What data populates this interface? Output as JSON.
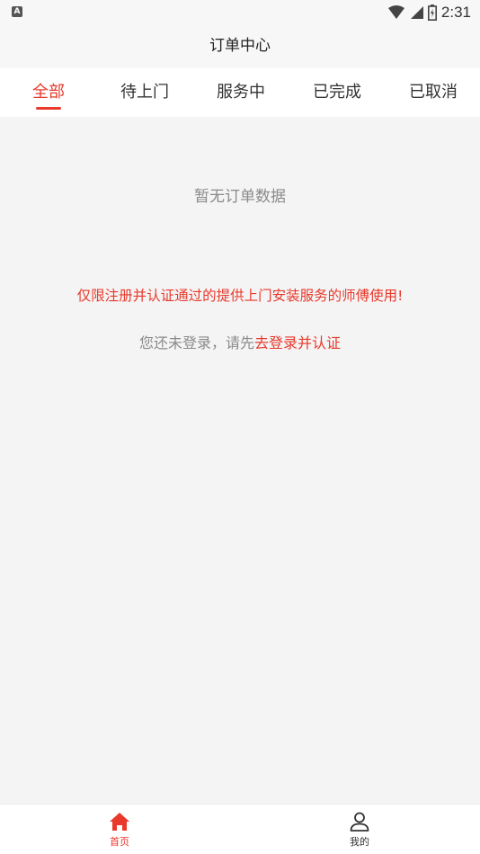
{
  "status_bar": {
    "indicator": "A",
    "time": "2:31",
    "icons": [
      "wifi-icon",
      "signal-icon",
      "battery-icon"
    ]
  },
  "header": {
    "title": "订单中心"
  },
  "tabs": [
    {
      "label": "全部",
      "active": true
    },
    {
      "label": "待上门",
      "active": false
    },
    {
      "label": "服务中",
      "active": false
    },
    {
      "label": "已完成",
      "active": false
    },
    {
      "label": "已取消",
      "active": false
    }
  ],
  "content": {
    "empty_text": "暂无订单数据",
    "notice": "仅限注册并认证通过的提供上门安装服务的师傅使用!",
    "login_prompt": "您还未登录，请先",
    "login_link": "去登录并认证"
  },
  "bottom_nav": [
    {
      "label": "首页",
      "icon": "home-icon",
      "active": true
    },
    {
      "label": "我的",
      "icon": "user-icon",
      "active": false
    }
  ],
  "colors": {
    "accent": "#e8392c",
    "background": "#f4f4f4",
    "muted_text": "#8a8a8a"
  }
}
